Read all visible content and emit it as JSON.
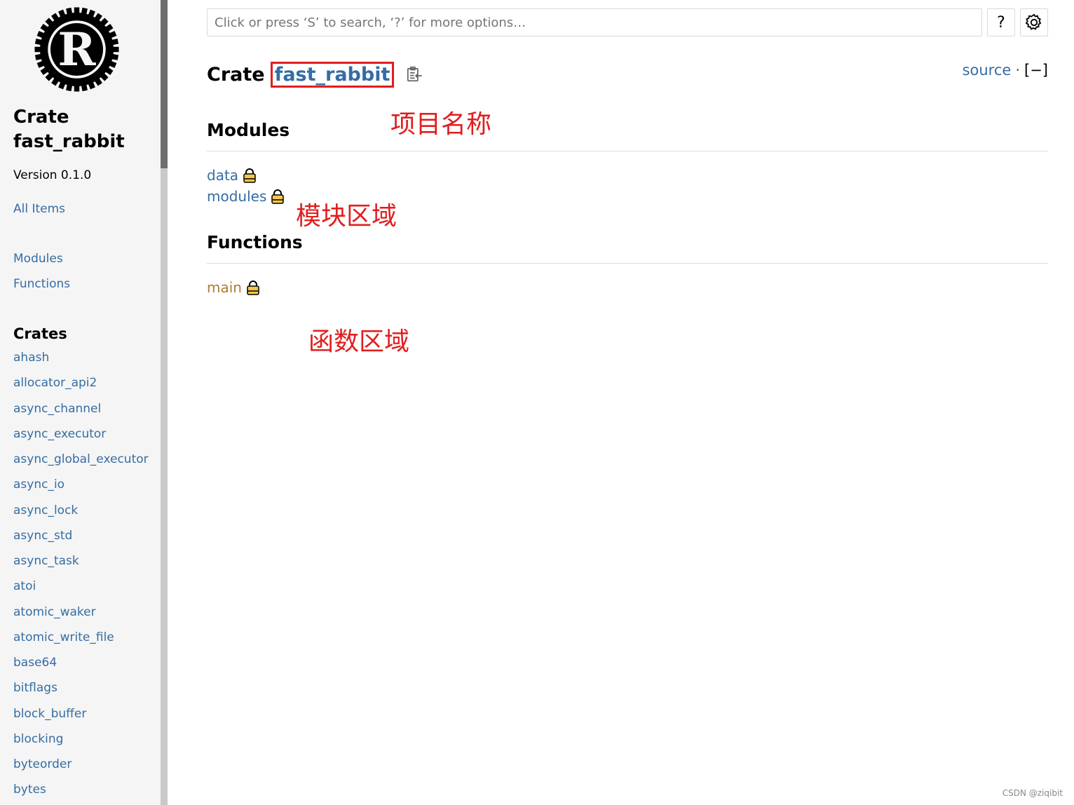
{
  "sidebar": {
    "crate_label": "Crate",
    "crate_name": "fast_rabbit",
    "version": "Version 0.1.0",
    "all_items": "All Items",
    "nav": [
      "Modules",
      "Functions"
    ],
    "crates_heading": "Crates",
    "crates": [
      "ahash",
      "allocator_api2",
      "async_channel",
      "async_executor",
      "async_global_executor",
      "async_io",
      "async_lock",
      "async_std",
      "async_task",
      "atoi",
      "atomic_waker",
      "atomic_write_file",
      "base64",
      "bitflags",
      "block_buffer",
      "blocking",
      "byteorder",
      "bytes"
    ]
  },
  "search": {
    "placeholder": "Click or press ‘S’ to search, ‘?’ for more options…"
  },
  "toolbar": {
    "help_label": "?"
  },
  "main": {
    "title_prefix": "Crate",
    "title_name": "fast_rabbit",
    "source": "source",
    "dot": "·",
    "toggle": "[−]",
    "modules_heading": "Modules",
    "modules": [
      "data",
      "modules"
    ],
    "functions_heading": "Functions",
    "functions": [
      "main"
    ]
  },
  "annotations": {
    "project_name": "项目名称",
    "module_area": "模块区域",
    "function_area": "函数区域"
  },
  "watermark": "CSDN @ziqibit",
  "colors": {
    "link": "#356da4",
    "function": "#ad7c37",
    "annotation": "#e11e1e",
    "lock": "#f5c74a"
  },
  "icons": [
    "rust-logo-icon",
    "gear-icon",
    "copy-icon",
    "lock-icon"
  ]
}
